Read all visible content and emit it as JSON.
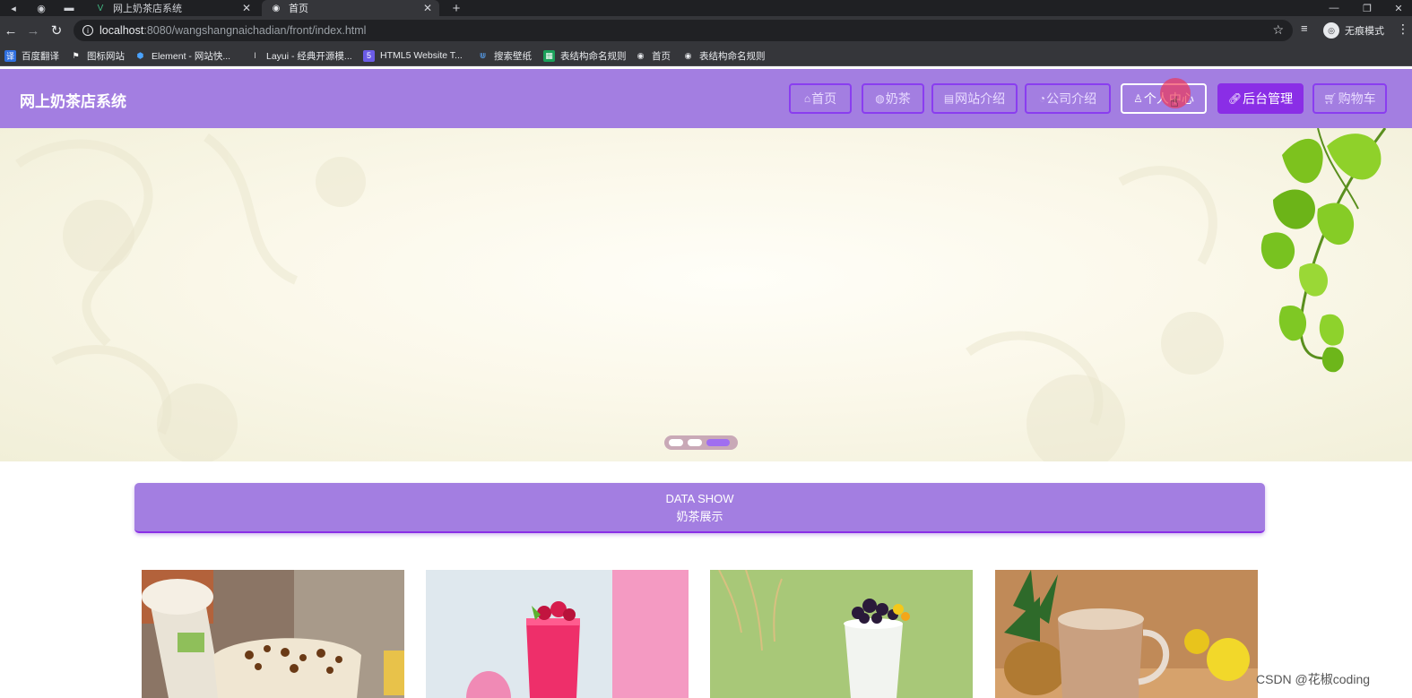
{
  "browser": {
    "tabs": [
      {
        "title": "网上奶茶店系统",
        "active": false
      },
      {
        "title": "首页",
        "active": true
      }
    ],
    "url_host": "localhost",
    "url_rest": ":8080/wangshangnaichadian/front/index.html",
    "incognito_label": "无痕模式",
    "bookmarks": [
      "百度翻译",
      "图标网站",
      "Element - 网站快...",
      "Layui - 经典开源模...",
      "HTML5 Website T...",
      "搜索壁纸",
      "表结构命名规则",
      "首页",
      "表结构命名规则"
    ]
  },
  "site": {
    "title": "网上奶茶店系统",
    "nav": [
      "首页",
      "奶茶",
      "网站介绍",
      "公司介绍",
      "个人中心",
      "后台管理",
      "购物车"
    ]
  },
  "carousel": {
    "slides": 3,
    "active_index": 3
  },
  "data_show": {
    "en": "DATA SHOW",
    "zh": "奶茶展示"
  },
  "products": [
    {
      "name": "product-1",
      "theme": "caramel-frappe"
    },
    {
      "name": "product-2",
      "theme": "pink-berry"
    },
    {
      "name": "product-3",
      "theme": "grape-tea"
    },
    {
      "name": "product-4",
      "theme": "milk-tea"
    }
  ],
  "watermark": "CSDN @花椒coding",
  "colors": {
    "header": "#a37ee1",
    "accent": "#8a2ee6"
  }
}
